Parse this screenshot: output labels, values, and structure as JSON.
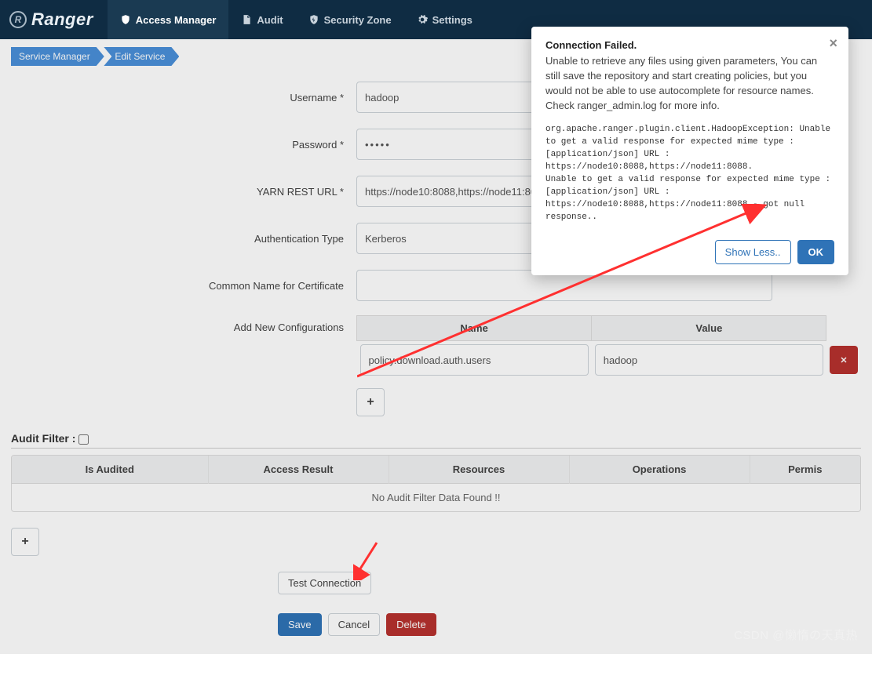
{
  "brand": {
    "name": "Ranger",
    "badge": "R"
  },
  "nav": {
    "access": "Access Manager",
    "audit": "Audit",
    "security": "Security Zone",
    "settings": "Settings"
  },
  "breadcrumb": {
    "service_manager": "Service Manager",
    "edit_service": "Edit Service"
  },
  "form": {
    "username_label": "Username *",
    "username_value": "hadoop",
    "password_label": "Password *",
    "password_value": "•••••",
    "rest_label": "YARN REST URL *",
    "rest_value": "https://node10:8088,https://node11:8088",
    "auth_label": "Authentication Type",
    "auth_value": "Kerberos",
    "cert_label": "Common Name for Certificate",
    "cert_value": "",
    "conf_label": "Add New Configurations",
    "conf_col_name": "Name",
    "conf_col_value": "Value",
    "conf_row_name": "policy.download.auth.users",
    "conf_row_value": "hadoop",
    "add_btn": "+",
    "audit_filter_label": "Audit Filter :",
    "audit_cols": {
      "is_audited": "Is Audited",
      "access_result": "Access Result",
      "resources": "Resources",
      "operations": "Operations",
      "permis": "Permis"
    },
    "audit_empty": "No Audit Filter Data Found !!",
    "add_btn2": "+",
    "test_conn": "Test Connection",
    "save": "Save",
    "cancel": "Cancel",
    "delete": "Delete"
  },
  "modal": {
    "title": "Connection Failed.",
    "desc": "Unable to retrieve any files using given parameters, You can still save the repository and start creating policies, but you would not be able to use autocomplete for resource names. Check ranger_admin.log for more info.",
    "trace": "org.apache.ranger.plugin.client.HadoopException: Unable to get a valid response for expected mime type : [application/json] URL : https://node10:8088,https://node11:8088.\nUnable to get a valid response for expected mime type : [application/json] URL : https://node10:8088,https://node11:8088 - got null response..",
    "show_less": "Show Less..",
    "ok": "OK"
  },
  "watermark": "CSDN @懒惰の天真热"
}
